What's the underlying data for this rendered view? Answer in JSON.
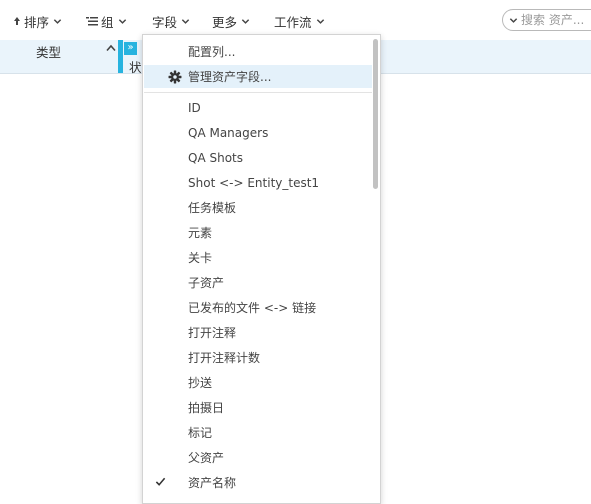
{
  "toolbar": {
    "sort_label": "排序",
    "group_label": "组",
    "fields_label": "字段",
    "more_label": "更多",
    "workflow_label": "工作流"
  },
  "search": {
    "placeholder": "搜索 资产..."
  },
  "table": {
    "col_type": "类型",
    "col_status": "状",
    "expand_symbol": "»"
  },
  "menu": {
    "configure_columns": "配置列...",
    "manage_fields": "管理资产字段...",
    "items": [
      "ID",
      "QA Managers",
      "QA Shots",
      "Shot <-> Entity_test1",
      "任务模板",
      "元素",
      "关卡",
      "子资产",
      "已发布的文件 <-> 链接",
      "打开注释",
      "打开注释计数",
      "抄送",
      "拍摄日",
      "标记",
      "父资产",
      "资产名称"
    ],
    "checked_item": "资产名称"
  },
  "icons": {
    "sort": "sort-arrow-icon",
    "group": "group-list-icon",
    "chevron": "chevron-down-icon",
    "gear": "gear-icon",
    "check": "check-icon"
  },
  "colors": {
    "accent": "#27b3df",
    "header_bg": "#eaf4fb",
    "menu_highlight": "#e4f1fa"
  }
}
